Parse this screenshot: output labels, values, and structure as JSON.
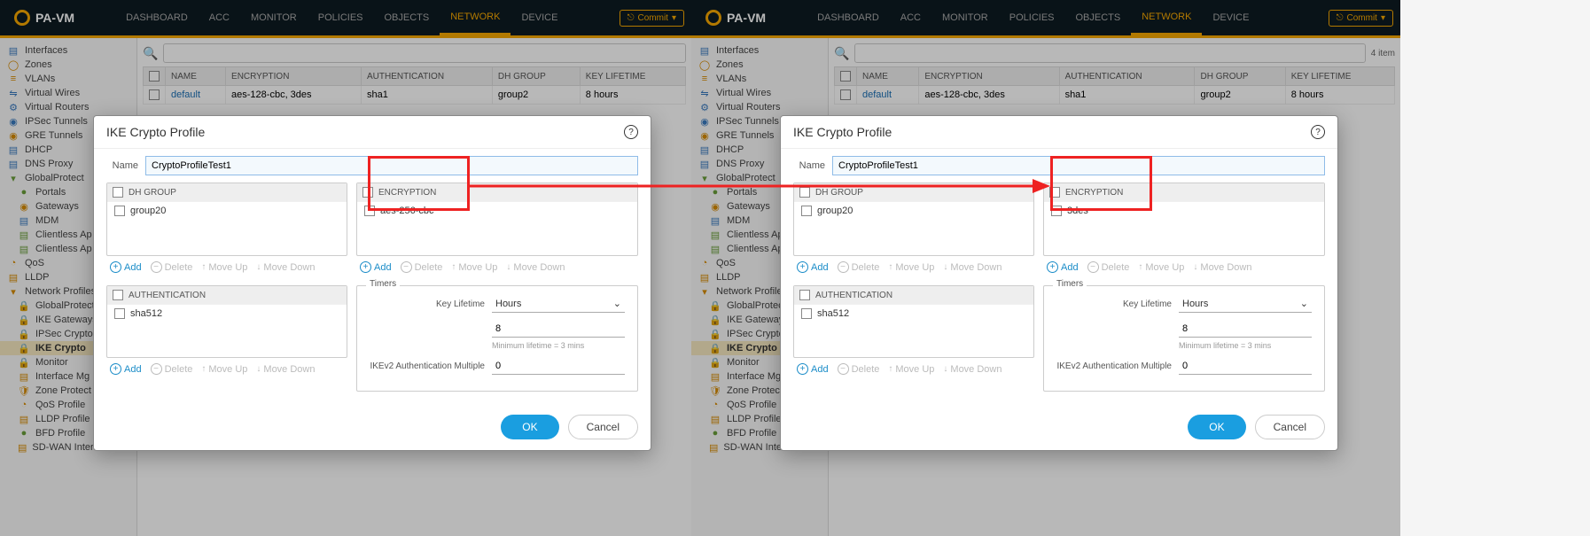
{
  "app": {
    "name": "PA-VM"
  },
  "nav": {
    "dashboard": "DASHBOARD",
    "acc": "ACC",
    "monitor": "MONITOR",
    "policies": "POLICIES",
    "objects": "OBJECTS",
    "network": "NETWORK",
    "device": "DEVICE",
    "commit": "Commit"
  },
  "sidebar": {
    "interfaces": "Interfaces",
    "zones": "Zones",
    "vlans": "VLANs",
    "virtual_wires": "Virtual Wires",
    "virtual_routers": "Virtual Routers",
    "ipsec_tunnels": "IPSec Tunnels",
    "gre_tunnels": "GRE Tunnels",
    "dhcp": "DHCP",
    "dns_proxy": "DNS Proxy",
    "globalprotect": "GlobalProtect",
    "portals": "Portals",
    "gateways": "Gateways",
    "mdm": "MDM",
    "clientless_apps": "Clientless Ap",
    "clientless_apps2": "Clientless Ap",
    "qos": "QoS",
    "lldp": "LLDP",
    "network_profiles": "Network Profiles",
    "globalprotect2": "GlobalProtect",
    "ike_gateways": "IKE Gateways",
    "ipsec_crypto": "IPSec Crypto",
    "ike_crypto": "IKE Crypto",
    "monitor2": "Monitor",
    "interface_mgmt": "Interface Mg",
    "zone_protect": "Zone Protect",
    "qos_profile": "QoS Profile",
    "lldp_profile": "LLDP Profile",
    "bfd_profile": "BFD Profile",
    "sdwan": "SD-WAN Interface Profile"
  },
  "table": {
    "items_count": "4 item",
    "cols": {
      "name": "NAME",
      "encryption": "ENCRYPTION",
      "authentication": "AUTHENTICATION",
      "dh_group": "DH GROUP",
      "key_lifetime": "KEY LIFETIME"
    },
    "row": {
      "name": "default",
      "encryption": "aes-128-cbc, 3des",
      "authentication": "sha1",
      "dh_group": "group2",
      "key_lifetime": "8 hours"
    }
  },
  "modal": {
    "title": "IKE Crypto Profile",
    "name_label": "Name",
    "name_value_left": "CryptoProfileTest1",
    "name_value_right": "CryptoProfileTest1",
    "headers": {
      "dh_group": "DH GROUP",
      "encryption": "ENCRYPTION",
      "authentication": "AUTHENTICATION"
    },
    "dh_value": "group20",
    "enc_value_left": "aes-256-cbc",
    "enc_value_right": "3des",
    "auth_value": "sha512",
    "tools": {
      "add": "Add",
      "delete": "Delete",
      "moveup": "Move Up",
      "movedown": "Move Down"
    },
    "timers": {
      "title": "Timers",
      "key_lifetime_label": "Key Lifetime",
      "key_lifetime_unit": "Hours",
      "key_lifetime_value": "8",
      "min_hint": "Minimum lifetime = 3 mins",
      "ikev2_label": "IKEv2 Authentication Multiple",
      "ikev2_value": "0"
    },
    "ok": "OK",
    "cancel": "Cancel"
  }
}
